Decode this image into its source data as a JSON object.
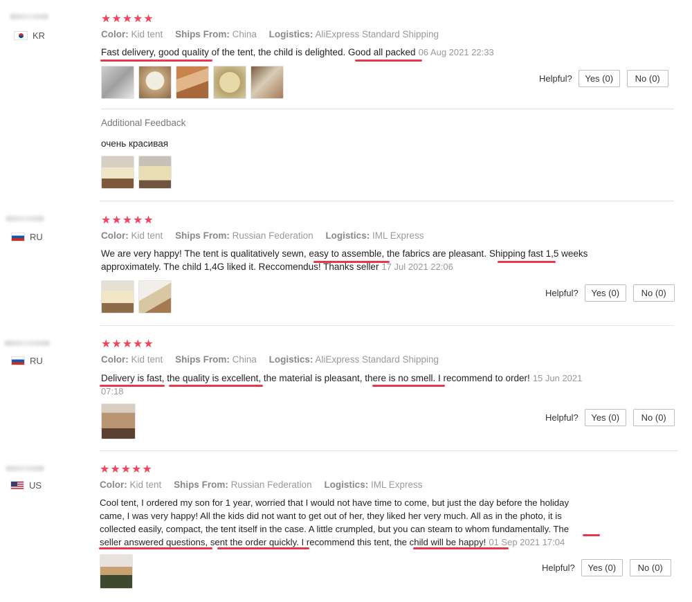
{
  "labels": {
    "color": "Color:",
    "ships_from": "Ships From:",
    "logistics": "Logistics:",
    "helpful": "Helpful?",
    "yes": "Yes (0)",
    "no": "No (0)",
    "additional_feedback": "Additional Feedback"
  },
  "rating_color": "#f1445d",
  "underline_color": "#e23a4b",
  "reviews": [
    {
      "country": "KR",
      "stars": "★★★★★",
      "rating": 5,
      "color": "Kid tent",
      "ships_from": "China",
      "logistics": "AliExpress Standard Shipping",
      "text_parts": [
        "Fast delivery, good quality",
        " of the tent, the child is delighted. ",
        "Good all packed"
      ],
      "date": "06 Aug 2021 22:33",
      "photo_count": 5,
      "additional_text": "очень красивая",
      "additional_photo_count": 2
    },
    {
      "country": "RU",
      "stars": "★★★★★",
      "rating": 5,
      "color": "Kid tent",
      "ships_from": "Russian Federation",
      "logistics": "IML Express",
      "text_parts": [
        "We are very happy! The tent is qualitatively sewn, ",
        "easy to assemble",
        ", the fabrics are pleasant. ",
        "Shipping fast",
        " 1,5 weeks",
        "approximately. The child 1,4G liked it. Reccomendus! Thanks seller"
      ],
      "date": "17 Jul 2021 22:06",
      "photo_count": 2
    },
    {
      "country": "RU",
      "stars": "★★★★★",
      "rating": 5,
      "color": "Kid tent",
      "ships_from": "China",
      "logistics": "AliExpress Standard Shipping",
      "text_parts": [
        "Delivery is fast",
        ", ",
        "the quality is excellent",
        ", the material is pleasant, ",
        "there is no smell",
        ". I recommend to order!"
      ],
      "date_1": "15 Jun 2021",
      "date_2": "07:18",
      "photo_count": 1
    },
    {
      "country": "US",
      "stars": "★★★★★",
      "rating": 5,
      "color": "Kid tent",
      "ships_from": "Russian Federation",
      "logistics": "IML Express",
      "lines": [
        "Cool tent, I ordered my son for 1 year, worried that I would not have time to come, but just the day before the holiday",
        "came, I was very happy! All the kids did not want to get out of her, they liked her very much. All as in the photo, it is",
        "collected easily, compact, the tent itself in the case. A little crumpled, but you can steam to whom fundamentally. "
      ],
      "text_parts": [
        "The",
        "seller answered questions",
        ", ",
        "sent the order quickly",
        ". I recommend this tent, ",
        "the child will be happy!"
      ],
      "date": "01 Sep 2021 17:04",
      "photo_count": 1
    }
  ]
}
